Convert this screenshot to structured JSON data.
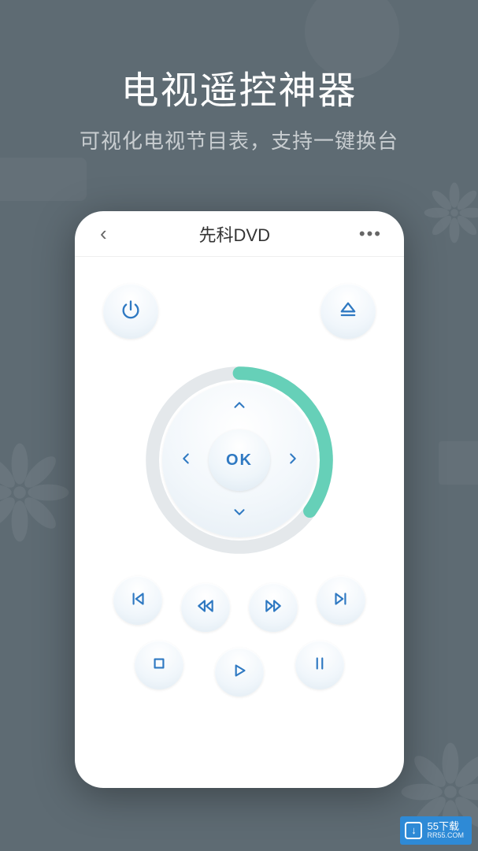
{
  "header": {
    "title": "电视遥控神器",
    "subtitle": "可视化电视节目表，支持一键换台"
  },
  "topbar": {
    "back_glyph": "‹",
    "device_name": "先科DVD",
    "more_glyph": "•••"
  },
  "dpad": {
    "ok_label": "OK"
  },
  "icons": {
    "power": "power-icon",
    "eject": "eject-icon",
    "up": "arrow-up-icon",
    "down": "arrow-down-icon",
    "left": "arrow-left-icon",
    "right": "arrow-right-icon",
    "prev": "skip-previous-icon",
    "rewind": "rewind-icon",
    "forward": "fast-forward-icon",
    "next": "skip-next-icon",
    "stop": "stop-icon",
    "play": "play-icon",
    "pause": "pause-icon"
  },
  "colors": {
    "accent": "#2f79c2",
    "ring_progress": "#66d0b8",
    "ring_track": "#e4e8eb",
    "bg": "#5e6b73"
  },
  "watermark": {
    "line1": "55下载",
    "line2": "RR55.COM",
    "icon_glyph": "↓"
  }
}
